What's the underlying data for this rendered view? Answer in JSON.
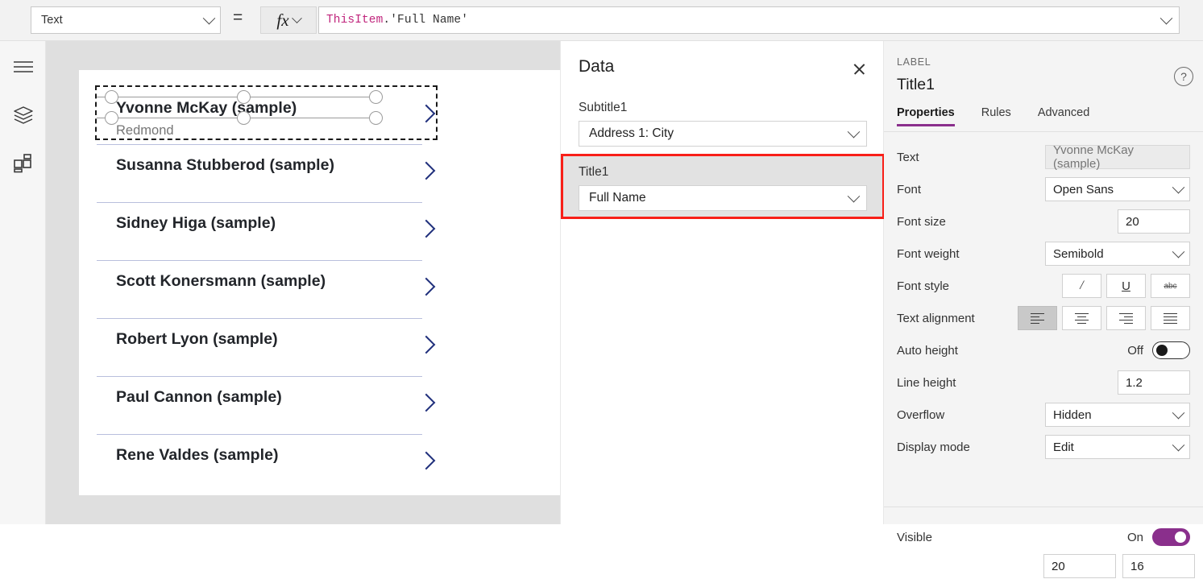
{
  "formula_bar": {
    "property_select": "Text",
    "equals": "=",
    "fx_label": "fx",
    "formula_token_object": "ThisItem",
    "formula_token_rest": ".'Full Name'"
  },
  "rail": {
    "menu_icon": "hamburger-menu-icon",
    "tree_icon": "layers-tree-view-icon",
    "insert_icon": "insert-components-icon"
  },
  "gallery": {
    "items": [
      {
        "name": "Yvonne McKay (sample)",
        "subtitle": "Redmond"
      },
      {
        "name": "Susanna Stubberod (sample)",
        "subtitle": ""
      },
      {
        "name": "Sidney Higa (sample)",
        "subtitle": ""
      },
      {
        "name": "Scott Konersmann (sample)",
        "subtitle": ""
      },
      {
        "name": "Robert Lyon (sample)",
        "subtitle": ""
      },
      {
        "name": "Paul Cannon (sample)",
        "subtitle": ""
      },
      {
        "name": "Rene Valdes (sample)",
        "subtitle": ""
      }
    ]
  },
  "data_panel": {
    "title": "Data",
    "close_label": "close-icon",
    "fields": [
      {
        "label": "Subtitle1",
        "value": "Address 1: City"
      },
      {
        "label": "Title1",
        "value": "Full Name"
      }
    ],
    "highlight_color": "#f81f18"
  },
  "properties_panel": {
    "kicker": "LABEL",
    "control_name": "Title1",
    "help_glyph": "?",
    "tabs": [
      {
        "label": "Properties",
        "active": true
      },
      {
        "label": "Rules",
        "active": false
      },
      {
        "label": "Advanced",
        "active": false
      }
    ],
    "accent_color": "#8a2f8c",
    "rows": {
      "text": {
        "label": "Text",
        "value": "Yvonne McKay (sample)"
      },
      "font": {
        "label": "Font",
        "value": "Open Sans"
      },
      "font_size": {
        "label": "Font size",
        "value": "20"
      },
      "font_weight": {
        "label": "Font weight",
        "value": "Semibold"
      },
      "font_style": {
        "label": "Font style",
        "italic": "/",
        "underline": "U",
        "strikethrough": "abc"
      },
      "text_alignment": {
        "label": "Text alignment"
      },
      "auto_height": {
        "label": "Auto height",
        "state": "Off"
      },
      "line_height": {
        "label": "Line height",
        "value": "1.2"
      },
      "overflow": {
        "label": "Overflow",
        "value": "Hidden"
      },
      "display_mode": {
        "label": "Display mode",
        "value": "Edit"
      },
      "visible": {
        "label": "Visible",
        "state": "On"
      },
      "partial_x": "20",
      "partial_y": "16"
    }
  }
}
